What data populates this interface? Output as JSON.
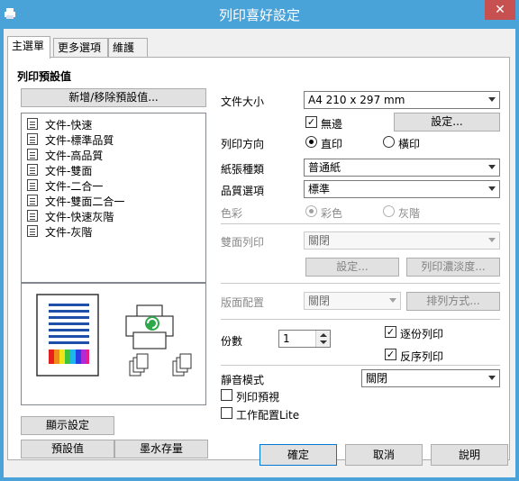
{
  "window": {
    "title": "列印喜好設定",
    "close_label": "✕"
  },
  "tabs": [
    "主選單",
    "更多選項",
    "維護"
  ],
  "presets": {
    "heading": "列印預設值",
    "add_remove_button": "新增/移除預設值...",
    "items": [
      "文件-快速",
      "文件-標準品質",
      "文件-高品質",
      "文件-雙面",
      "文件-二合一",
      "文件-雙面二合一",
      "文件-快速灰階",
      "文件-灰階"
    ]
  },
  "left_buttons": {
    "show_settings": "顯示設定",
    "defaults": "預設值",
    "ink_levels": "墨水存量"
  },
  "settings": {
    "document_size_label": "文件大小",
    "document_size_value": "A4 210 x 297 mm",
    "borderless_label": "無邊",
    "borderless_checked": true,
    "borderless_settings_button": "設定...",
    "orientation_label": "列印方向",
    "orientation_portrait": "直印",
    "orientation_landscape": "橫印",
    "paper_type_label": "紙張種類",
    "paper_type_value": "普通紙",
    "quality_label": "品質選項",
    "quality_value": "標準",
    "color_label": "色彩",
    "color_color": "彩色",
    "color_grayscale": "灰階",
    "duplex_label": "雙面列印",
    "duplex_value": "關閉",
    "duplex_settings_button": "設定...",
    "print_density_button": "列印濃淡度...",
    "layout_label": "版面配置",
    "layout_value": "關閉",
    "layout_order_button": "排列方式...",
    "copies_label": "份數",
    "copies_value": "1",
    "collate_label": "逐份列印",
    "collate_checked": true,
    "reverse_label": "反序列印",
    "reverse_checked": true,
    "quiet_mode_label": "靜音模式",
    "quiet_mode_value": "關閉",
    "print_preview_label": "列印預視",
    "print_preview_checked": false,
    "job_arranger_label": "工作配置Lite",
    "job_arranger_checked": false
  },
  "footer": {
    "ok": "確定",
    "cancel": "取消",
    "help": "說明"
  },
  "colors": {
    "titlebar": "#4aa3d8",
    "close_button": "#c75050"
  }
}
